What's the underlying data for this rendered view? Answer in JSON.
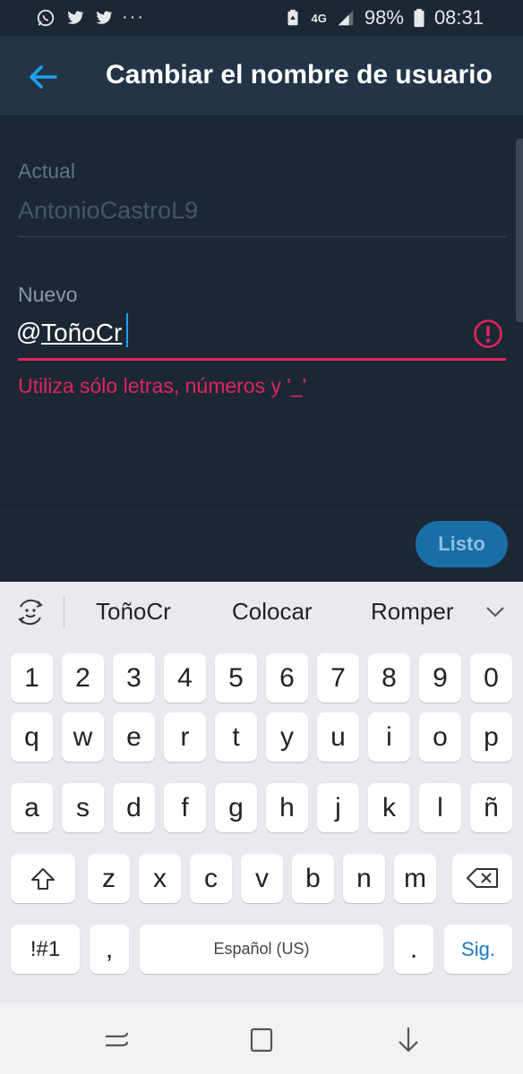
{
  "status_bar": {
    "battery": "98%",
    "time": "08:31",
    "network": "4G",
    "more": "···",
    "icons": [
      "whatsapp-icon",
      "twitter-icon",
      "twitter-icon",
      "more-notifications-icon",
      "battery-saver-icon",
      "signal-icon",
      "battery-icon"
    ]
  },
  "app_bar": {
    "title": "Cambiar el nombre de usuario",
    "back_icon": "back-arrow-icon",
    "accent": "#1da1f2"
  },
  "form": {
    "current_label": "Actual",
    "current_value": "AntonioCastroL9",
    "new_label": "Nuevo",
    "prefix": "@",
    "new_value": "ToñoCr",
    "error_text": "Utiliza sólo letras, números y '_'",
    "error_color": "#e0245e"
  },
  "toolbar": {
    "done_label": "Listo"
  },
  "keyboard": {
    "suggestions": [
      "ToñoCr",
      "Colocar",
      "Romper"
    ],
    "rows": {
      "numbers": [
        "1",
        "2",
        "3",
        "4",
        "5",
        "6",
        "7",
        "8",
        "9",
        "0"
      ],
      "row1": [
        "q",
        "w",
        "e",
        "r",
        "t",
        "y",
        "u",
        "i",
        "o",
        "p"
      ],
      "row2": [
        "a",
        "s",
        "d",
        "f",
        "g",
        "h",
        "j",
        "k",
        "l",
        "ñ"
      ],
      "row3": [
        "z",
        "x",
        "c",
        "v",
        "b",
        "n",
        "m"
      ]
    },
    "symbols_label": "!#1",
    "comma": ",",
    "space_label": "Español (US)",
    "period": ".",
    "enter_label": "Sig."
  },
  "nav_bar": {
    "icons": [
      "recent-apps-icon",
      "home-icon",
      "back-icon"
    ]
  }
}
